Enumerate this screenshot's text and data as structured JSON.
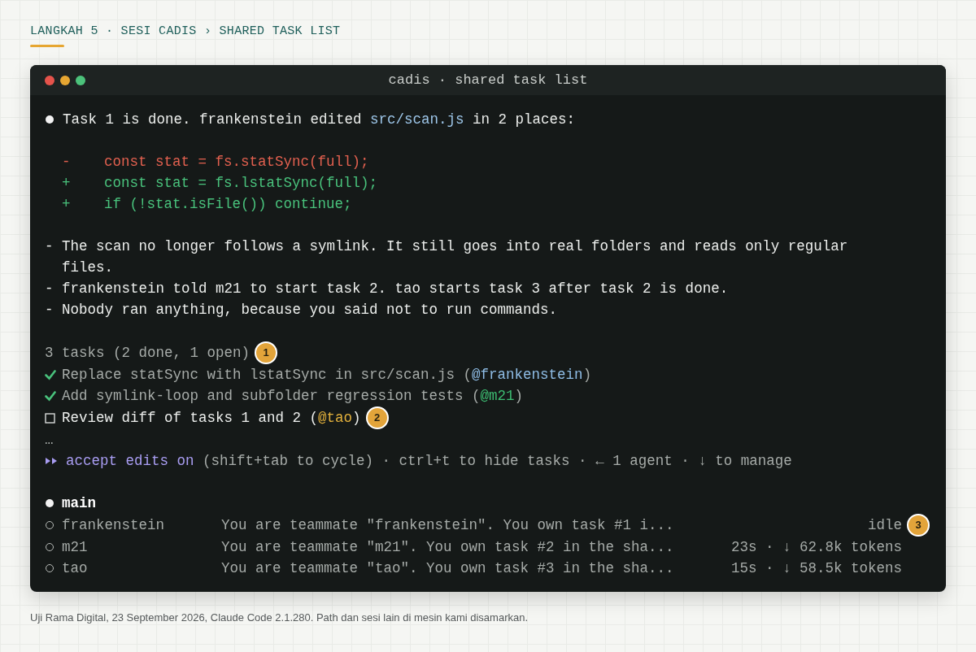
{
  "breadcrumb": "LANGKAH 5 · SESI CADIS › SHARED TASK LIST",
  "window": {
    "title": "cadis · shared task list"
  },
  "summary": [
    {
      "kind": "plain",
      "text": "Task 1 is done. frankenstein edited "
    },
    {
      "kind": "path",
      "text": "src/scan.js"
    },
    {
      "kind": "plain",
      "text": " in 2 places:"
    }
  ],
  "diff": [
    {
      "kind": "removed",
      "sign": "-",
      "code": "const stat = fs.statSync(full);"
    },
    {
      "kind": "added",
      "sign": "+",
      "code": "const stat = fs.lstatSync(full);"
    },
    {
      "kind": "added",
      "sign": "+",
      "code": "if (!stat.isFile()) continue;"
    }
  ],
  "notes": [
    {
      "marker": "-",
      "text": "The scan no longer follows a symlink. It still goes into real folders and reads only regular files."
    },
    {
      "marker": "-",
      "text": "frankenstein told m21 to start task 2. tao starts task 3 after task 2 is done."
    },
    {
      "marker": "-",
      "text": "Nobody ran anything, because you said not to run commands."
    }
  ],
  "tasks": {
    "summary": "3 tasks (2 done, 1 open)",
    "badge": "1",
    "items": [
      {
        "checked": true,
        "text": "Replace statSync with lstatSync in src/scan.js (",
        "owner": "@frankenstein",
        "close": ")",
        "color": "#8fbde6"
      },
      {
        "checked": true,
        "text": "Add symlink-loop and subfolder regression tests (",
        "owner": "@m21",
        "close": ")",
        "color": "#3dbd72"
      },
      {
        "checked": false,
        "text": "Review diff of tasks 1 and 2 (",
        "owner": "@tao",
        "close": ")",
        "color": "#e3b13c",
        "badge": "2"
      }
    ],
    "more": "…"
  },
  "mode_line": {
    "mode": "accept edits on",
    "hint": "(shift+tab to cycle) · ctrl+t to hide tasks · ← 1 agent · ↓ to manage"
  },
  "agents": [
    {
      "name": "main",
      "selected": true
    },
    {
      "name": "frankenstein",
      "selected": false,
      "description": "You are teammate \"frankenstein\". You own task #1 i...",
      "status": "idle",
      "badge": "3"
    },
    {
      "name": "m21",
      "selected": false,
      "description": "You are teammate \"m21\". You own task #2 in the sha...",
      "status": "23s · ↓ 62.8k tokens"
    },
    {
      "name": "tao",
      "selected": false,
      "description": "You are teammate \"tao\". You own task #3 in the sha...",
      "status": "15s · ↓ 58.5k tokens"
    }
  ],
  "caption": "Uji Rama Digital, 23 September 2026, Claude Code 2.1.280. Path dan sesi lain di mesin kami disamarkan."
}
